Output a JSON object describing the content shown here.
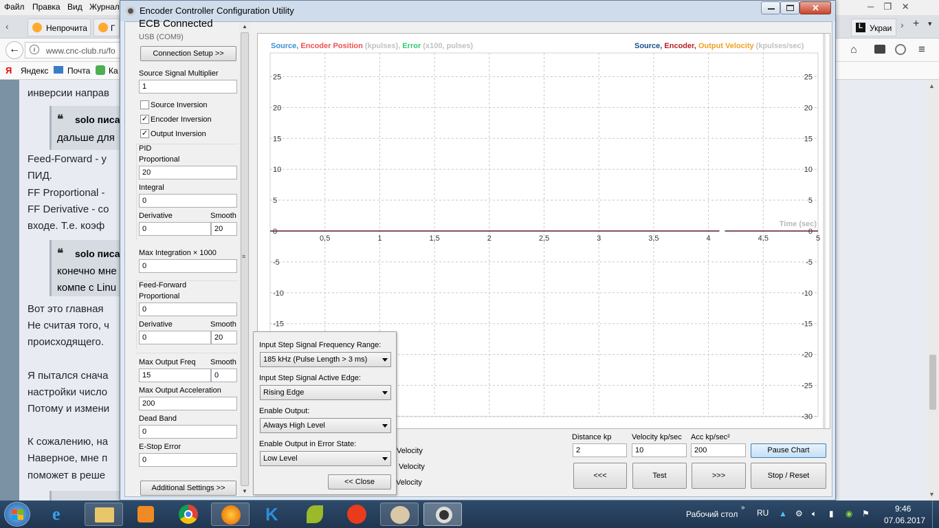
{
  "browser": {
    "menu": [
      "Файл",
      "Правка",
      "Вид",
      "Журнал"
    ],
    "tabs": [
      {
        "label": "Непрочита"
      },
      {
        "label": "Г"
      },
      {
        "label": "Украи"
      }
    ],
    "url": "www.cnc-club.ru/fo",
    "bookmarks": [
      "Яндекс",
      "Почта",
      "Ка"
    ]
  },
  "page": {
    "lines": [
      "инверсии направ",
      "Feed-Forward - у",
      "ПИД.",
      "FF Proportional -",
      "FF Derivative - со",
      "входе. Т.е. коэф",
      "Вот это главная",
      "Не считая того, ч",
      "происходящего.",
      "Я пытался снача",
      "настройки число",
      "Потому и измени",
      "К сожалению, на",
      "Наверное, мне п",
      "поможет в реше"
    ],
    "quote1": {
      "author": "solo писа",
      "text": "дальше для"
    },
    "quote2": {
      "author": "solo писа",
      "text1": "конечно мне",
      "text2": "компе с Linu"
    }
  },
  "window": {
    "title": "Encoder Controller Configuration Utility",
    "status": "ECB Connected",
    "port": "USB (COM9)",
    "connection_setup": "Connection Setup >>",
    "source_multiplier_label": "Source Signal Multiplier",
    "source_multiplier": "1",
    "source_inversion": {
      "label": "Source Inversion",
      "checked": false
    },
    "encoder_inversion": {
      "label": "Encoder Inversion",
      "checked": true
    },
    "output_inversion": {
      "label": "Output Inversion",
      "checked": true
    },
    "pid_label": "PID",
    "proportional_label": "Proportional",
    "proportional": "20",
    "integral_label": "Integral",
    "integral": "0",
    "derivative_label": "Derivative",
    "derivative": "0",
    "smooth_label": "Smooth",
    "derivative_smooth": "20",
    "max_integration_label": "Max Integration × 1000",
    "max_integration": "0",
    "ff_label": "Feed-Forward",
    "ff_proportional_label": "Proportional",
    "ff_proportional": "0",
    "ff_derivative_label": "Derivative",
    "ff_derivative": "0",
    "ff_smooth": "20",
    "max_output_freq_label": "Max Output Freq",
    "max_output_freq": "15",
    "freq_smooth": "0",
    "max_output_acc_label": "Max Output Acceleration",
    "max_output_acc": "200",
    "dead_band_label": "Dead Band",
    "dead_band": "0",
    "estop_label": "E-Stop Error",
    "estop": "0",
    "additional_settings": "Additional Settings >>"
  },
  "popup": {
    "freq_range_label": "Input Step Signal Frequency Range:",
    "freq_range": "185 kHz (Pulse Length > 3 ms)",
    "active_edge_label": "Input Step Signal Active Edge:",
    "active_edge": "Rising Edge",
    "enable_output_label": "Enable Output:",
    "enable_output": "Always High Level",
    "enable_error_label": "Enable Output in Error State:",
    "enable_error": "Low Level",
    "close": "<< Close"
  },
  "bottom": {
    "velocity_labels": [
      "Velocity",
      "Velocity",
      "Velocity"
    ],
    "distance_label": "Distance kp",
    "distance": "2",
    "velocity_label": "Velocity kp/sec",
    "velocity": "10",
    "acc_label": "Acc  kp/sec²",
    "acc": "200",
    "pause": "Pause Chart",
    "back": "<<<",
    "test": "Test",
    "forward": ">>>",
    "stop": "Stop / Reset"
  },
  "chart_data": {
    "type": "line",
    "legend_left": [
      {
        "text": "Source, ",
        "color": "#3c8fd6"
      },
      {
        "text": "Encoder Position ",
        "color": "#f05050"
      },
      {
        "text": "(kpulses), ",
        "color": "#c0c0c0"
      },
      {
        "text": "Error ",
        "color": "#2ecc71"
      },
      {
        "text": "(x100, pulses)",
        "color": "#c0c0c0"
      }
    ],
    "legend_right": [
      {
        "text": "Source, ",
        "color": "#1a4d8a"
      },
      {
        "text": "Encoder, ",
        "color": "#b81e1e"
      },
      {
        "text": "Output Velocity ",
        "color": "#f0a020"
      },
      {
        "text": "(kpulses/sec)",
        "color": "#c0c0c0"
      }
    ],
    "xlabel": "Time (sec)",
    "xlim": [
      0,
      5
    ],
    "ylim": [
      -30,
      25
    ],
    "x_ticks": [
      "0,5",
      "1",
      "1,5",
      "2",
      "2,5",
      "3",
      "3,5",
      "4",
      "4,5",
      "5"
    ],
    "y_ticks": [
      25,
      20,
      15,
      10,
      5,
      0,
      -5,
      -10,
      -15,
      -20,
      -25,
      -30
    ],
    "grid": true,
    "series": [
      {
        "x": [
          0,
          4.1
        ],
        "y": [
          0,
          0
        ],
        "color": "#5a1a2a"
      },
      {
        "x": [
          4.15,
          5
        ],
        "y": [
          0,
          0
        ],
        "color": "#5a1a2a"
      }
    ]
  },
  "taskbar": {
    "desktop": "Рабочий стол",
    "lang": "RU",
    "time": "9:46",
    "date": "07.06.2017"
  }
}
